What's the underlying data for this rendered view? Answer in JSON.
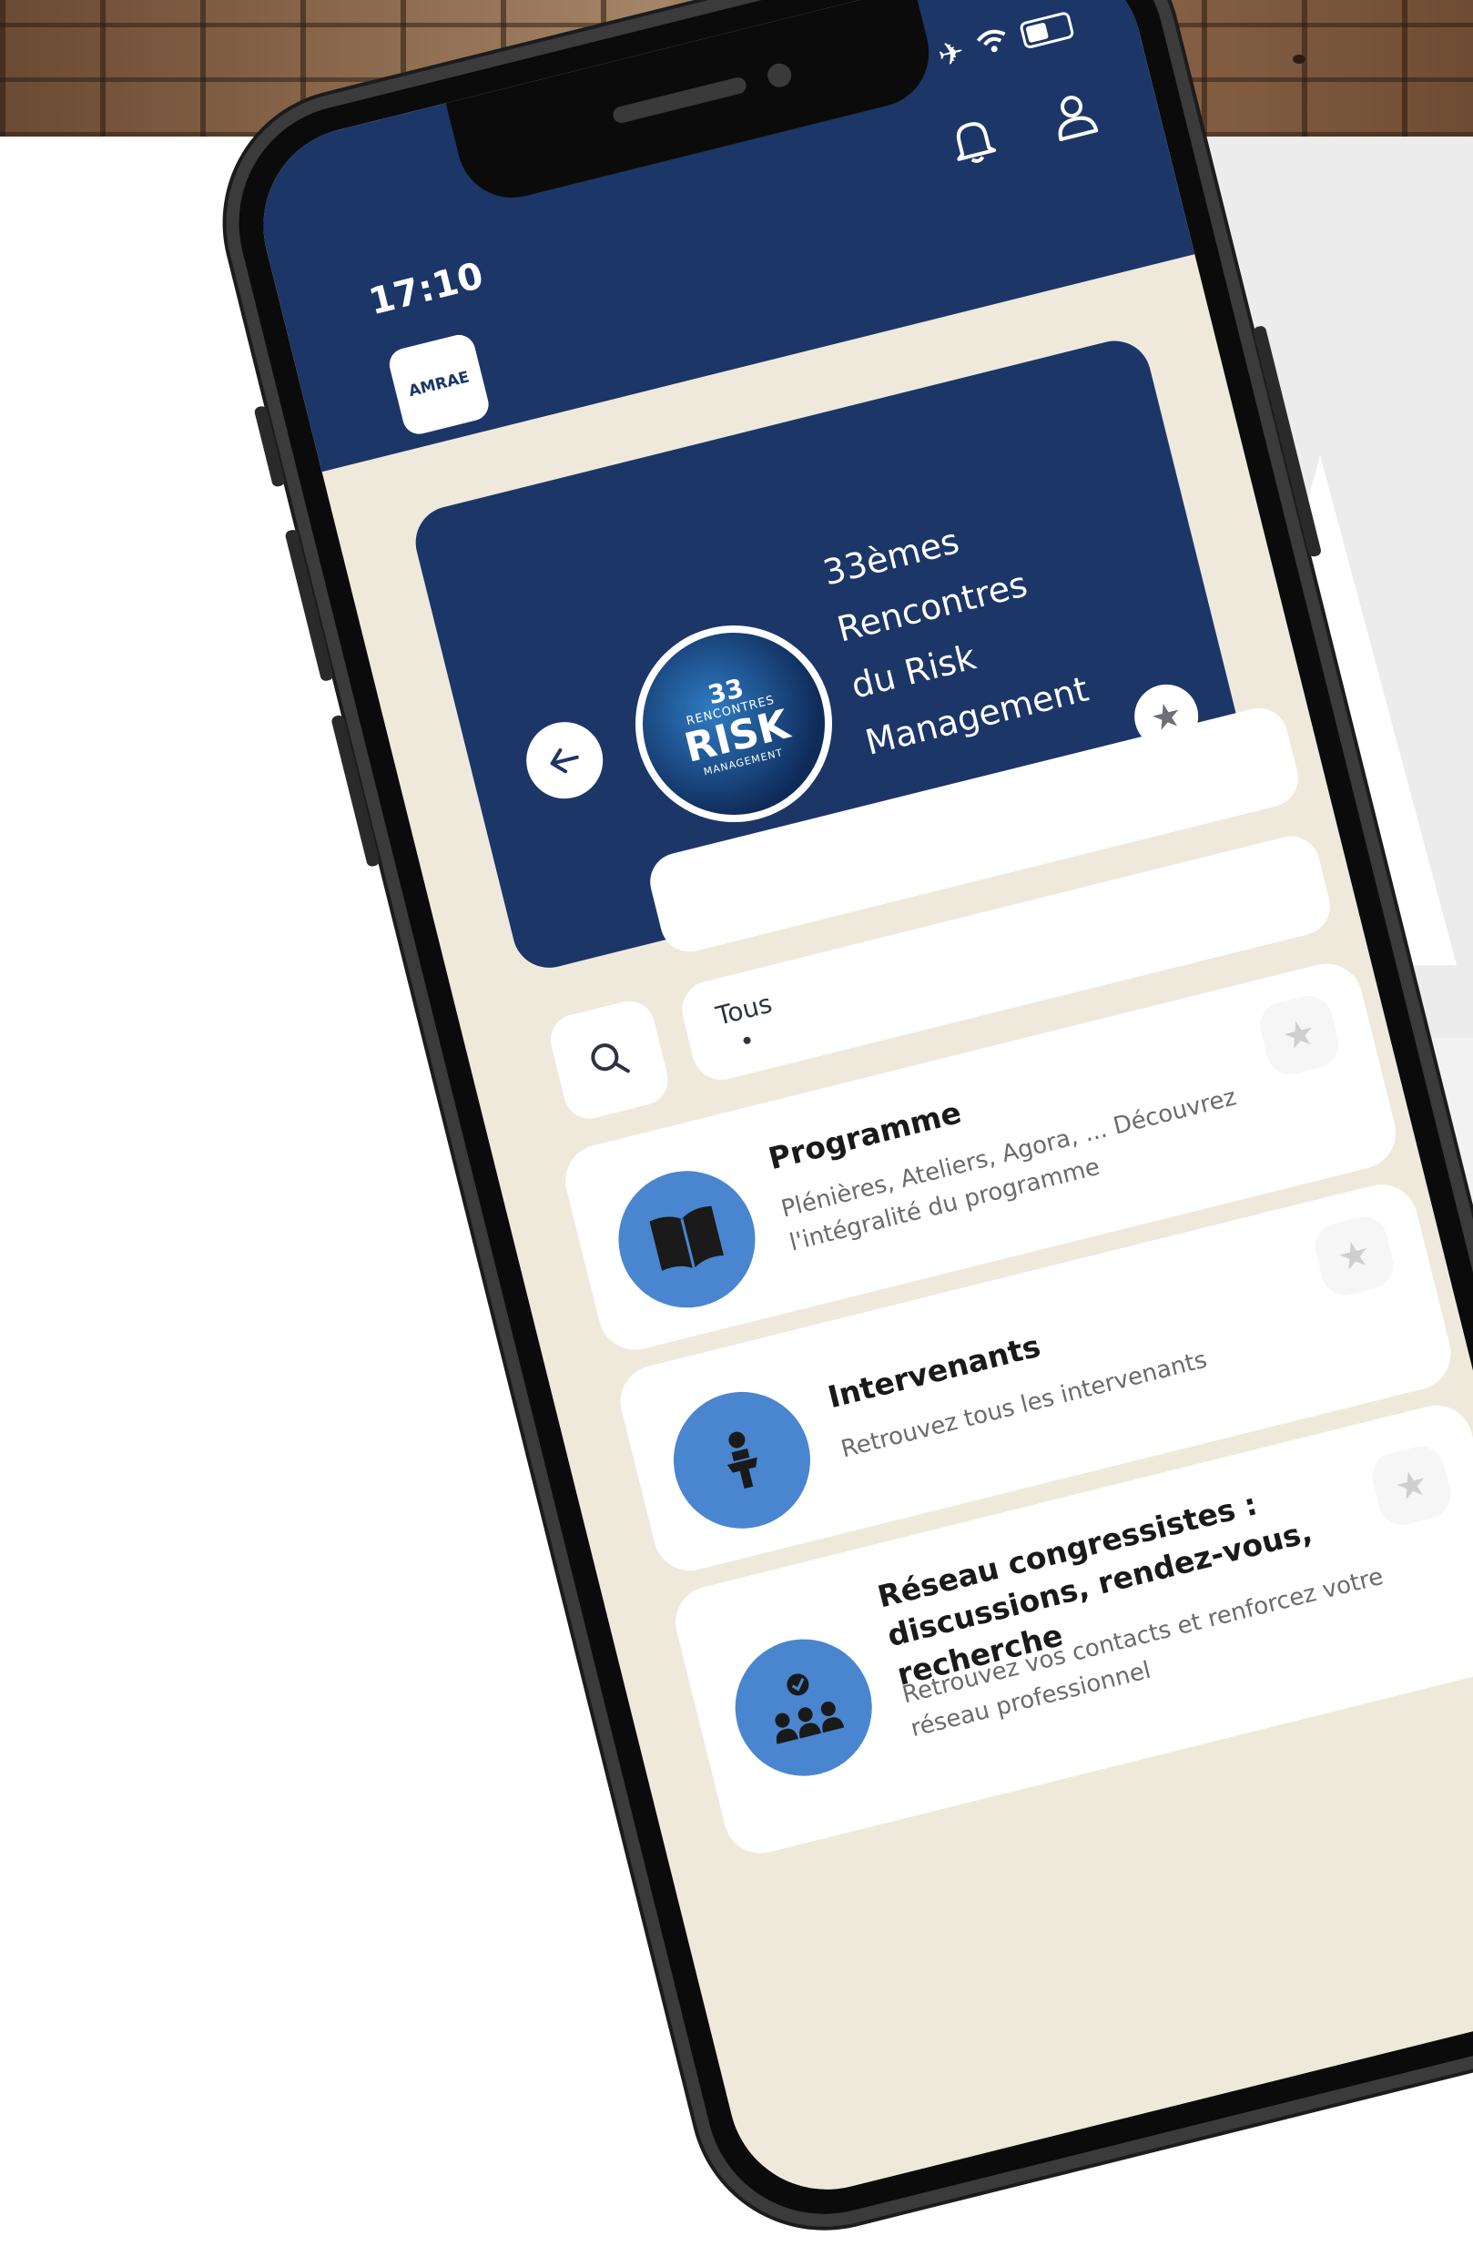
{
  "status_bar": {
    "time": "17:10"
  },
  "header": {
    "logo_text": "AMRAE",
    "bell_icon": "bell-icon",
    "profile_icon": "user-icon"
  },
  "event": {
    "title": "33èmes Rencontres du Risk Management",
    "title_lines": [
      "33èmes Rencontres",
      "du Risk",
      "Management"
    ],
    "logo_lines": [
      "33",
      "RENCONTRES",
      "RISK",
      "MANAGEMENT"
    ]
  },
  "filters": {
    "search_icon": "search-icon",
    "active": "Tous"
  },
  "items": [
    {
      "title": "Programme",
      "description": "Plénières, Ateliers, Agora, ... Découvrez l'intégralité du programme",
      "icon": "book-icon"
    },
    {
      "title": "Intervenants",
      "description": "Retrouvez tous les intervenants",
      "icon": "speaker-podium-icon"
    },
    {
      "title": "Réseau congressistes : discussions, rendez-vous, recherche",
      "description": "Retrouvez vos contacts et renforcez votre réseau professionnel",
      "icon": "network-people-icon"
    }
  ],
  "colors": {
    "navy": "#1c3668",
    "accent_blue": "#4a85d0",
    "screen_bg": "#efe9dc"
  }
}
